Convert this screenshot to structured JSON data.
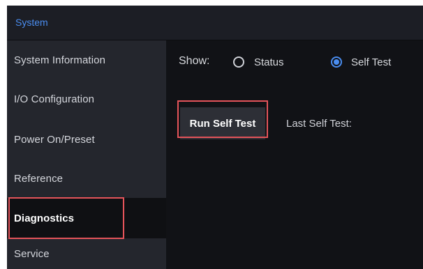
{
  "header": {
    "title": "System"
  },
  "sidebar": {
    "items": [
      {
        "label": "System Information"
      },
      {
        "label": "I/O Configuration"
      },
      {
        "label": "Power On/Preset"
      },
      {
        "label": "Reference"
      },
      {
        "label": "Diagnostics",
        "selected": true
      },
      {
        "label": "Service"
      }
    ]
  },
  "main": {
    "show_label": "Show:",
    "options": [
      {
        "label": "Status",
        "checked": false
      },
      {
        "label": "Self Test",
        "checked": true
      }
    ],
    "run_button_label": "Run Self Test",
    "last_self_test_label": "Last Self Test:"
  },
  "colors": {
    "accent": "#4a8df0",
    "highlight": "#e5545a",
    "panel_bg": "#111216",
    "sidebar_bg": "#24262d"
  }
}
